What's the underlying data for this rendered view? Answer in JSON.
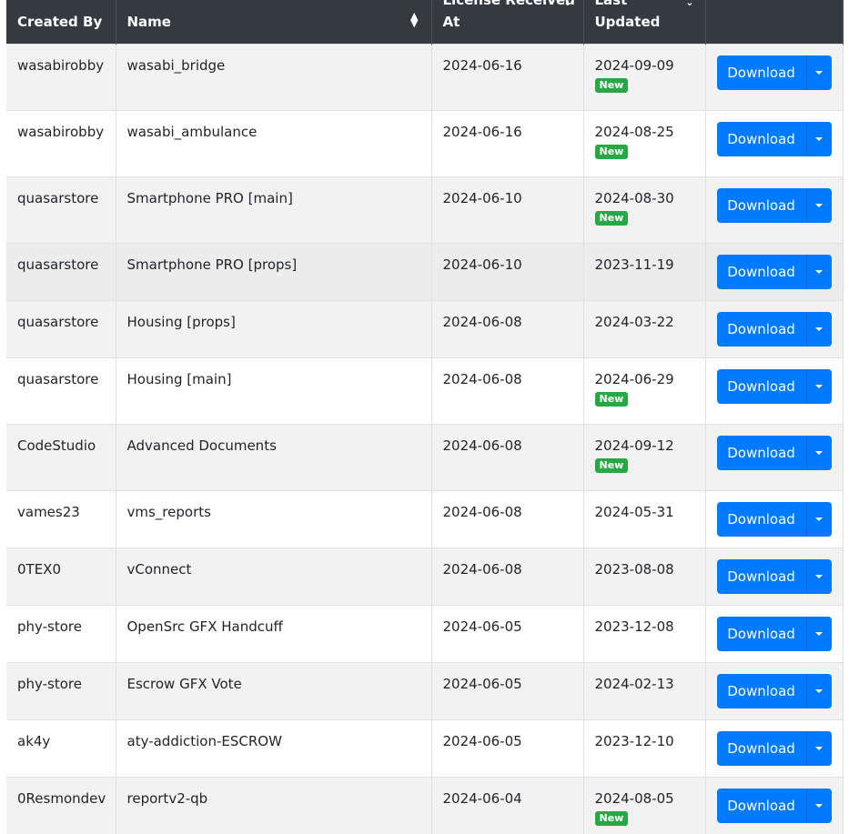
{
  "columns": {
    "created_by": "Created By",
    "name": "Name",
    "license_line1": "License Received",
    "license_line2": "At",
    "updated_line1": "Last",
    "updated_line2": "Updated"
  },
  "download_label": "Download",
  "new_badge": "New",
  "rows": [
    {
      "created_by": "wasabirobby",
      "name": "wasabi_bridge",
      "license": "2024-06-16",
      "updated": "2024-09-09",
      "is_new": true
    },
    {
      "created_by": "wasabirobby",
      "name": "wasabi_ambulance",
      "license": "2024-06-16",
      "updated": "2024-08-25",
      "is_new": true
    },
    {
      "created_by": "quasarstore",
      "name": "Smartphone PRO [main]",
      "license": "2024-06-10",
      "updated": "2024-08-30",
      "is_new": true
    },
    {
      "created_by": "quasarstore",
      "name": "Smartphone PRO [props]",
      "license": "2024-06-10",
      "updated": "2023-11-19",
      "is_new": false
    },
    {
      "created_by": "quasarstore",
      "name": "Housing [props]",
      "license": "2024-06-08",
      "updated": "2024-03-22",
      "is_new": false
    },
    {
      "created_by": "quasarstore",
      "name": "Housing [main]",
      "license": "2024-06-08",
      "updated": "2024-06-29",
      "is_new": true
    },
    {
      "created_by": "CodeStudio",
      "name": "Advanced Documents",
      "license": "2024-06-08",
      "updated": "2024-09-12",
      "is_new": true
    },
    {
      "created_by": "vames23",
      "name": "vms_reports",
      "license": "2024-06-08",
      "updated": "2024-05-31",
      "is_new": false
    },
    {
      "created_by": "0TEX0",
      "name": "vConnect",
      "license": "2024-06-08",
      "updated": "2023-08-08",
      "is_new": false
    },
    {
      "created_by": "phy-store",
      "name": "OpenSrc GFX Handcuff",
      "license": "2024-06-05",
      "updated": "2023-12-08",
      "is_new": false
    },
    {
      "created_by": "phy-store",
      "name": "Escrow GFX Vote",
      "license": "2024-06-05",
      "updated": "2024-02-13",
      "is_new": false
    },
    {
      "created_by": "ak4y",
      "name": "aty-addiction-ESCROW",
      "license": "2024-06-05",
      "updated": "2023-12-10",
      "is_new": false
    },
    {
      "created_by": "0Resmondev",
      "name": "reportv2-qb",
      "license": "2024-06-04",
      "updated": "2024-08-05",
      "is_new": true
    }
  ]
}
